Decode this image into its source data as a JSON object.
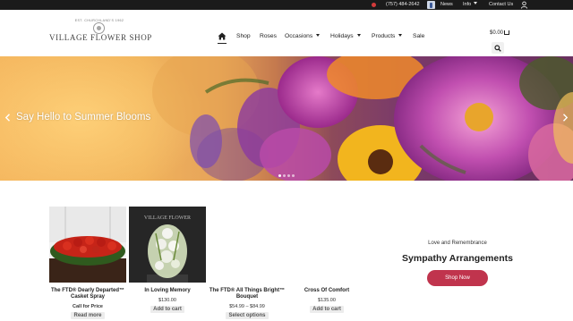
{
  "topbar": {
    "phone": "(757) 484-2642",
    "news": "News",
    "info": "Info",
    "contact": "Contact Us",
    "icons": [
      "phone-icon",
      "facebook-icon",
      "user-icon"
    ]
  },
  "logo": {
    "name": "VILLAGE FLOWER SHOP",
    "tagline": "EST. CHURCHLAND'S 1962"
  },
  "nav": {
    "items": [
      {
        "label": "Shop"
      },
      {
        "label": "Roses"
      },
      {
        "label": "Occasions"
      },
      {
        "label": "Holidays"
      },
      {
        "label": "Products"
      },
      {
        "label": "Sale"
      }
    ],
    "home_icon": "home-icon"
  },
  "cart": {
    "total": "$0.00"
  },
  "hero": {
    "title": "Say Hello to Summer Blooms",
    "slides_count": 4,
    "active_slide": 1
  },
  "products": [
    {
      "name": "The FTD® Dearly Departed™ Casket Spray",
      "price": "Call for Price",
      "action": "Read more"
    },
    {
      "name": "In Loving Memory",
      "price": "$130.00",
      "action": "Add to cart"
    },
    {
      "name": "The FTD® All Things Bright™ Bouquet",
      "price": "$54.99 – $84.99",
      "action": "Select options"
    },
    {
      "name": "Cross Of Comfort",
      "price": "$135.00",
      "action": "Add to cart"
    }
  ],
  "product_image_text": "VILLAGE FLOWER",
  "promo": {
    "eyebrow": "Love and Remembrance",
    "title": "Sympathy Arrangements",
    "button": "Shop Now"
  },
  "colors": {
    "topbar": "#1b1b1b",
    "accent": "#c0344d",
    "text": "#222222"
  }
}
